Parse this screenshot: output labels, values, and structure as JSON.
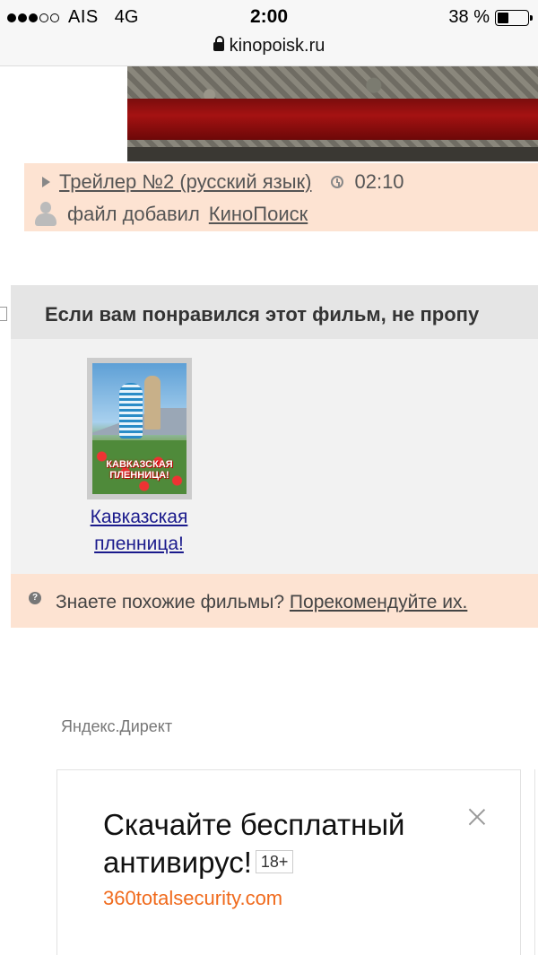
{
  "status_bar": {
    "carrier": "AIS",
    "network": "4G",
    "time": "2:00",
    "battery_percent": "38 %",
    "signal_bars_filled": 3,
    "signal_bars_total": 5,
    "battery_level": 0.38
  },
  "url_bar": {
    "domain": "kinopoisk.ru",
    "secure_icon": "lock-icon"
  },
  "trailer": {
    "title": "Трейлер №2 (русский язык)",
    "duration": "02:10",
    "added_by_label": "файл добавил",
    "added_by_user": "КиноПоиск"
  },
  "recommendations": {
    "heading": "Если вам понравился этот фильм, не пропу",
    "items": [
      {
        "title_line1": "Кавказская",
        "title_line2": "пленница!",
        "poster_text": "КАВКАЗСКАЯ ПЛЕННИЦА!"
      }
    ],
    "footer_text": "Знаете похожие фильмы?",
    "footer_link": "Порекомендуйте их."
  },
  "ad": {
    "source_label": "Яндекс.Директ",
    "headline": "Скачайте бесплатный антивирус!",
    "age_badge": "18+",
    "domain": "360totalsecurity.com",
    "accent_color": "#f06a1c"
  },
  "colors": {
    "peach": "#fde3d2",
    "gray_band": "#e5e5e5",
    "link_blue": "#1a1a8c"
  }
}
